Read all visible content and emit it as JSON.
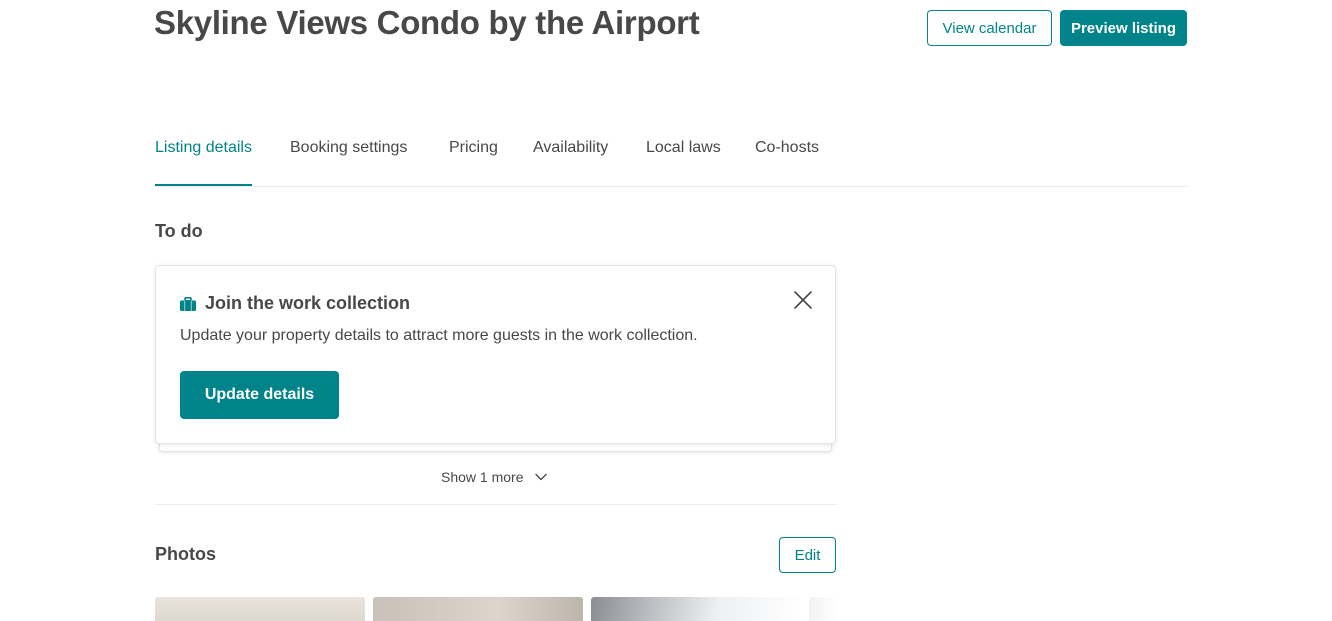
{
  "header": {
    "title": "Skyline Views Condo by the Airport",
    "view_calendar": "View calendar",
    "preview_listing": "Preview listing"
  },
  "tabs": [
    {
      "label": "Listing details",
      "active": true
    },
    {
      "label": "Booking settings",
      "active": false
    },
    {
      "label": "Pricing",
      "active": false
    },
    {
      "label": "Availability",
      "active": false
    },
    {
      "label": "Local laws",
      "active": false
    },
    {
      "label": "Co-hosts",
      "active": false
    }
  ],
  "todo": {
    "heading": "To do",
    "card": {
      "icon": "briefcase-icon",
      "title": "Join the work collection",
      "text": "Update your property details to attract more guests in the work collection.",
      "button": "Update details",
      "close_icon": "close-icon"
    },
    "show_more": "Show 1 more",
    "show_more_icon": "chevron-down-icon"
  },
  "photos": {
    "heading": "Photos",
    "edit": "Edit"
  },
  "colors": {
    "accent": "#00848A",
    "text": "#484848",
    "border": "#ebebeb"
  }
}
